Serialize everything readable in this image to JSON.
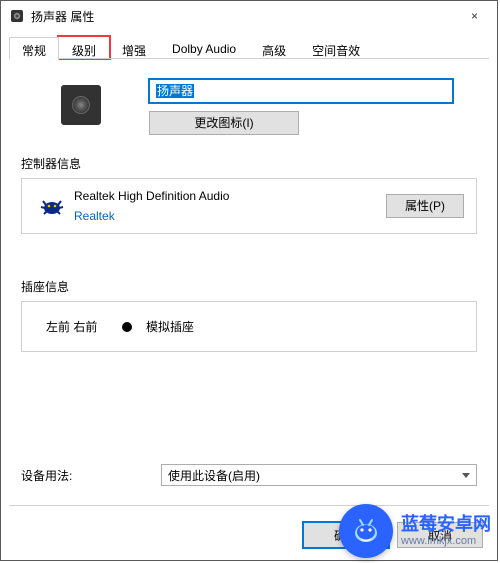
{
  "window": {
    "title": "扬声器 属性",
    "close": "×"
  },
  "tabs": [
    {
      "label": "常规",
      "active": true,
      "highlight": false
    },
    {
      "label": "级别",
      "active": false,
      "highlight": true
    },
    {
      "label": "增强",
      "active": false,
      "highlight": false
    },
    {
      "label": "Dolby Audio",
      "active": false,
      "highlight": false
    },
    {
      "label": "高级",
      "active": false,
      "highlight": false
    },
    {
      "label": "空间音效",
      "active": false,
      "highlight": false
    }
  ],
  "general": {
    "device_name": "扬声器",
    "change_icon_btn": "更改图标(I)"
  },
  "controller": {
    "section_label": "控制器信息",
    "name": "Realtek High Definition Audio",
    "vendor": "Realtek",
    "properties_btn": "属性(P)"
  },
  "jack": {
    "section_label": "插座信息",
    "location": "左前 右前",
    "type": "模拟插座",
    "color": "#000000"
  },
  "usage": {
    "label": "设备用法:",
    "selected": "使用此设备(启用)"
  },
  "footer": {
    "ok": "确定",
    "cancel": "取消"
  },
  "watermark": {
    "title": "蓝莓安卓网",
    "url": "www.lmkjx.com"
  }
}
